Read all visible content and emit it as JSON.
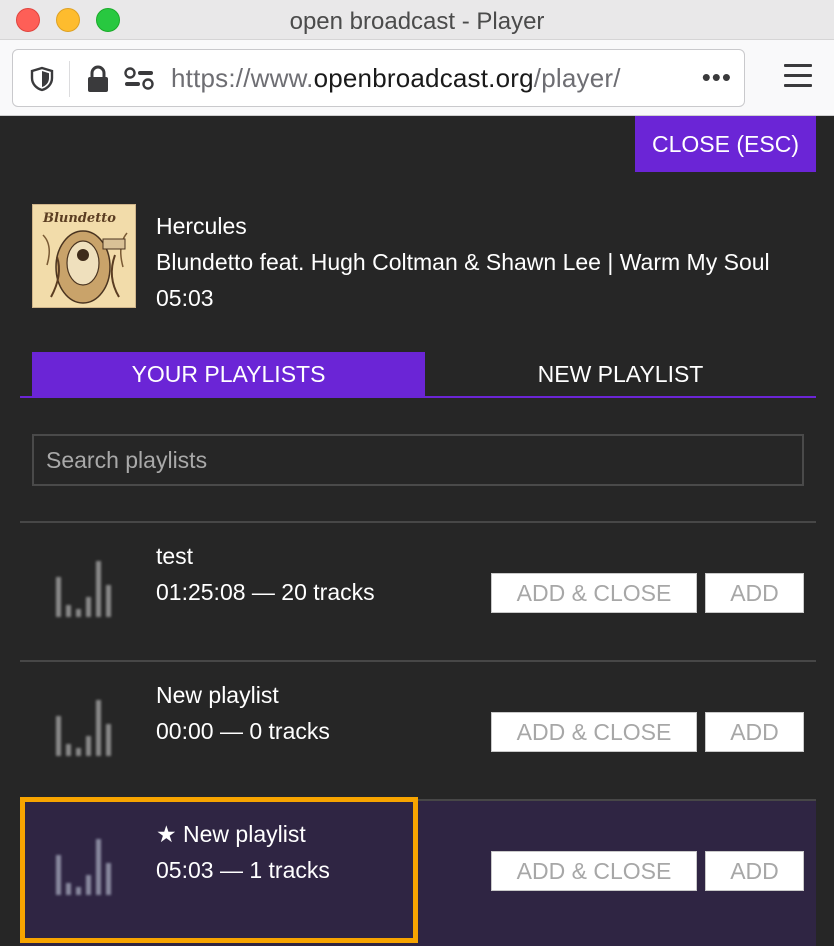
{
  "window": {
    "title": "open broadcast - Player"
  },
  "urlbar": {
    "prefix": "https://www.",
    "domain": "openbroadcast.org",
    "path": "/player/",
    "more": "•••"
  },
  "icons": {
    "shield": "shield-icon",
    "lock": "lock-icon",
    "permissions": "permissions-icon",
    "menu": "hamburger-menu-icon",
    "playlist": "playlist-bars-icon",
    "star": "star-icon"
  },
  "colors": {
    "accent": "#6b25d6",
    "highlight": "#f7a400",
    "background": "#262626",
    "selected_row": "#2f2543"
  },
  "close_button": "CLOSE (ESC)",
  "now_playing": {
    "title": "Hercules",
    "artist_release": "Blundetto feat. Hugh Coltman & Shawn Lee | Warm My Soul",
    "duration": "05:03",
    "cover_text": "Blundetto"
  },
  "tabs": {
    "your_playlists": "YOUR PLAYLISTS",
    "new_playlist": "NEW PLAYLIST"
  },
  "search": {
    "placeholder": "Search playlists",
    "value": ""
  },
  "playlists": [
    {
      "name": "test",
      "meta": "01:25:08 — 20 tracks",
      "starred": false,
      "add_close": "ADD & CLOSE",
      "add": "ADD"
    },
    {
      "name": "New playlist",
      "meta": "00:00 — 0 tracks",
      "starred": false,
      "add_close": "ADD & CLOSE",
      "add": "ADD"
    },
    {
      "name": "New playlist",
      "meta": "05:03 — 1 tracks",
      "starred": true,
      "star": "★",
      "add_close": "ADD & CLOSE",
      "add": "ADD"
    }
  ]
}
